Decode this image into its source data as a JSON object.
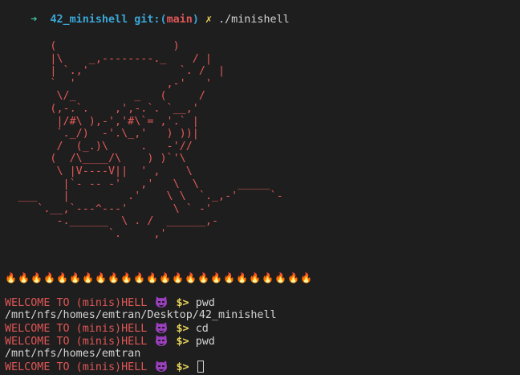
{
  "shell_prompt": {
    "arrow": "➜",
    "directory": "42_minishell",
    "git_label": "git:(",
    "branch": "main",
    "git_close": ")",
    "dirty_mark": "✗",
    "command": "./minishell"
  },
  "ascii_art": "       (                  )\n       |\\    _,--------._    / |\n       | `.,'              `. /  |\n       `  '              ,-'   '\n        \\/_         _   (     /\n       (,-.`.    ,',-.`. `__,'\n        |/#\\ ),-','#\\`= ,'.` |\n        `._/)  -'.\\_,'   ) ))|\n        /  (_.)\\     .   -'//\n       (  /\\____/\\    ) )`'\\\n        \\ |V----V||  ' ,    \\\n         |`- -- -'   ,'   \\  \\      _____\n  ___    |         .'    \\ \\  `._,-'     `-\n     `.__,`---^---'       \\ ` -'\n        -.______  \\ . /  ______,-\n                `.     ,'",
  "fire_banner": {
    "icon": "fire-icon",
    "count": 24,
    "glyph": "🔥"
  },
  "history": [
    {
      "type": "prompt",
      "text": "WELCOME TO (minis)HELL",
      "symbol": "$>",
      "command": "pwd"
    },
    {
      "type": "output",
      "text": "/mnt/nfs/homes/emtran/Desktop/42_minishell"
    },
    {
      "type": "prompt",
      "text": "WELCOME TO (minis)HELL",
      "symbol": "$>",
      "command": "cd"
    },
    {
      "type": "prompt",
      "text": "WELCOME TO (minis)HELL",
      "symbol": "$>",
      "command": "pwd"
    },
    {
      "type": "output",
      "text": "/mnt/nfs/homes/emtran"
    },
    {
      "type": "prompt",
      "text": "WELCOME TO (minis)HELL",
      "symbol": "$>",
      "command": ""
    }
  ],
  "colors": {
    "background": "#1e1e1e",
    "arrow": "#3fbfa0",
    "directory": "#3aa7d8",
    "branch": "#e05656",
    "art": "#e35a5a",
    "welcome": "#e05656",
    "prompt_symbol": "#e8d35a",
    "devil": "#9b3fbf"
  },
  "devil_icon": "smiling-imp-icon"
}
